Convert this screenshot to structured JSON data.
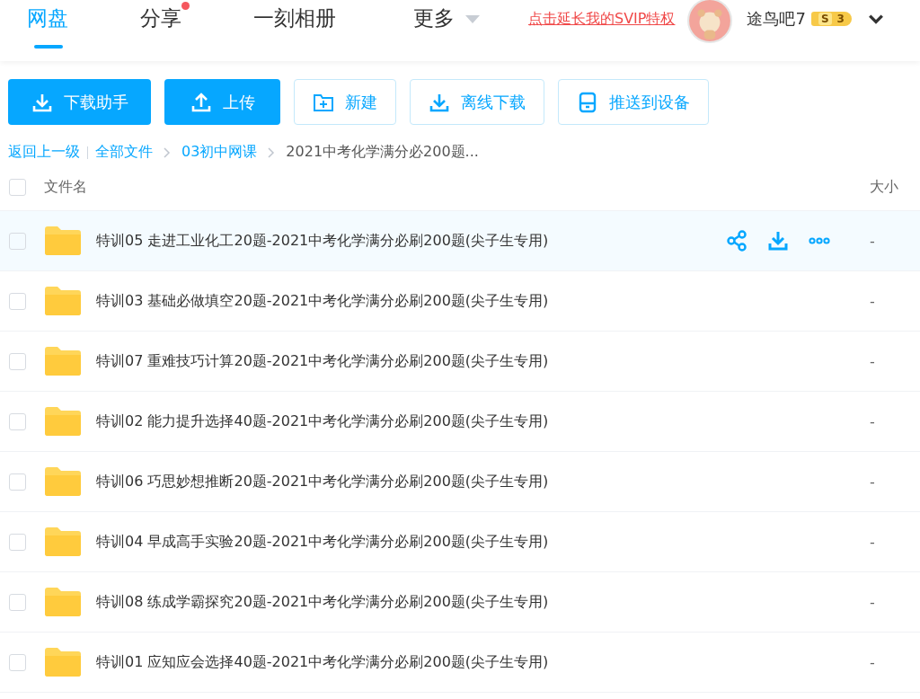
{
  "nav": {
    "tabs": [
      {
        "label": "网盘",
        "selected": true,
        "dot": false,
        "dropdown": false
      },
      {
        "label": "分享",
        "selected": false,
        "dot": true,
        "dropdown": false
      },
      {
        "label": "一刻相册",
        "selected": false,
        "dot": false,
        "dropdown": false
      },
      {
        "label": "更多",
        "selected": false,
        "dot": false,
        "dropdown": true
      }
    ],
    "promo_link": "点击延长我的SVIP特权",
    "user": {
      "name": "途鸟吧7",
      "badge_letter": "S",
      "badge_level": "3"
    }
  },
  "toolbar": [
    {
      "label": "下载助手",
      "kind": "primary"
    },
    {
      "label": "上传",
      "kind": "primary"
    },
    {
      "label": "新建",
      "kind": "outline"
    },
    {
      "label": "离线下载",
      "kind": "outline"
    },
    {
      "label": "推送到设备",
      "kind": "outline"
    }
  ],
  "breadcrumb": {
    "back": "返回上一级",
    "links": [
      "全部文件",
      "03初中网课"
    ],
    "current": "2021中考化学满分必200题..."
  },
  "table": {
    "all_checked": false,
    "columns": [
      "文件名",
      "大小"
    ],
    "rows": [
      {
        "name": "特训05 走进工业化工20题-2021中考化学满分必刷200题(尖子生专用)",
        "size": "-",
        "checked": false,
        "highlighted": true
      },
      {
        "name": "特训03 基础必做填空20题-2021中考化学满分必刷200题(尖子生专用)",
        "size": "-",
        "checked": false,
        "highlighted": false
      },
      {
        "name": "特训07 重难技巧计算20题-2021中考化学满分必刷200题(尖子生专用)",
        "size": "-",
        "checked": false,
        "highlighted": false
      },
      {
        "name": "特训02 能力提升选择40题-2021中考化学满分必刷200题(尖子生专用)",
        "size": "-",
        "checked": false,
        "highlighted": false
      },
      {
        "name": "特训06 巧思妙想推断20题-2021中考化学满分必刷200题(尖子生专用)",
        "size": "-",
        "checked": false,
        "highlighted": false
      },
      {
        "name": "特训04 早成高手实验20题-2021中考化学满分必刷200题(尖子生专用)",
        "size": "-",
        "checked": false,
        "highlighted": false
      },
      {
        "name": "特训08 练成学霸探究20题-2021中考化学满分必刷200题(尖子生专用)",
        "size": "-",
        "checked": false,
        "highlighted": false
      },
      {
        "name": "特训01 应知应会选择40题-2021中考化学满分必刷200题(尖子生专用)",
        "size": "-",
        "checked": false,
        "highlighted": false
      }
    ]
  }
}
